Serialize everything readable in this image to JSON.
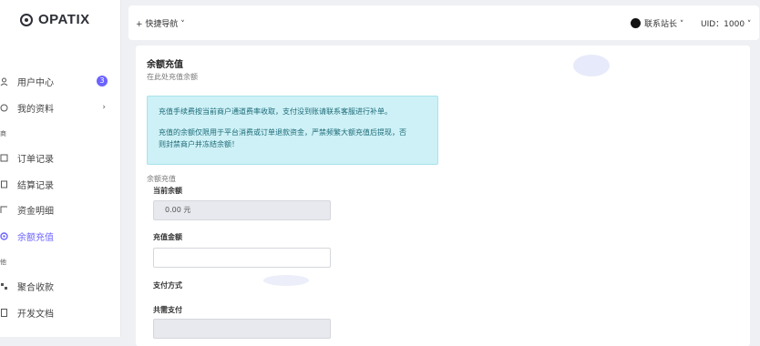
{
  "brand": {
    "name": "OPATIX"
  },
  "sidebar": {
    "items": [
      {
        "label": "用户中心",
        "icon": "user-icon",
        "badge": "3"
      },
      {
        "label": "我的资料",
        "icon": "profile-icon",
        "chevron": "›"
      },
      {
        "label": "订单记录",
        "icon": "order-icon"
      },
      {
        "label": "结算记录",
        "icon": "settlement-icon"
      },
      {
        "label": "资金明细",
        "icon": "funds-icon"
      },
      {
        "label": "余额充值",
        "icon": "recharge-icon",
        "active": true
      },
      {
        "label": "聚合收款",
        "icon": "qrcode-icon"
      },
      {
        "label": "开发文档",
        "icon": "doc-icon"
      }
    ],
    "sections": [
      "商",
      "他"
    ]
  },
  "topbar": {
    "quicknav": "+ 快捷导航 ˅",
    "contact": "联系站长 ˅",
    "uid": "UID：1000 ˅"
  },
  "page": {
    "title": "余额充值",
    "subtitle": "在此处充值余额",
    "alert_line1": "充值手续费按当前商户通道费率收取，支付没到账请联系客服进行补单。",
    "alert_line2": "充值的余额仅限用于平台消费或订单退款资金，严禁频繁大额充值后提现，否",
    "alert_line3": "则封禁商户并冻结余额！",
    "fieldset": "余额充值",
    "current_balance_label": "当前余额",
    "current_balance_value": "0.00 元",
    "amount_label": "充值金额",
    "amount_value": "",
    "pay_method_label": "支付方式",
    "total_label": "共需支付"
  },
  "colors": {
    "accent": "#6c63ff",
    "alert_bg": "#cdf1f6",
    "alert_text": "#1d6a78"
  }
}
